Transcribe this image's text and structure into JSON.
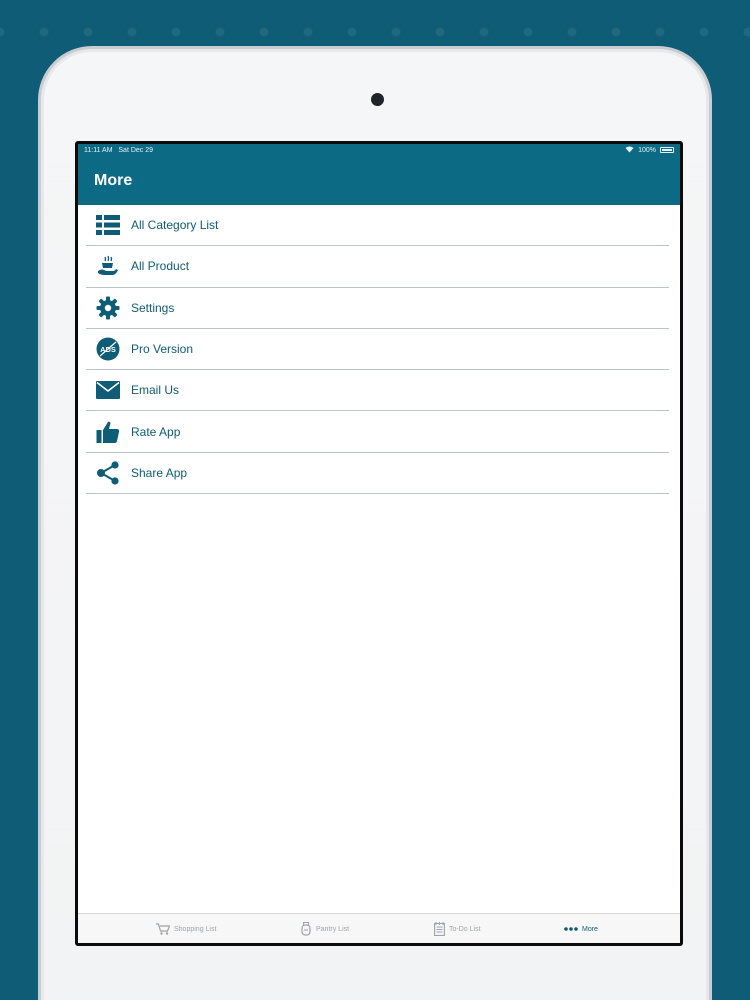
{
  "status_bar": {
    "time": "11:11 AM",
    "date": "Sat Dec 29",
    "battery": "100%"
  },
  "nav": {
    "title": "More"
  },
  "menu": [
    {
      "label": "All Category List",
      "icon": "list-icon"
    },
    {
      "label": "All Product",
      "icon": "product-hand-icon"
    },
    {
      "label": "Settings",
      "icon": "gear-icon"
    },
    {
      "label": "Pro Version",
      "icon": "no-ads-icon"
    },
    {
      "label": "Email Us",
      "icon": "envelope-icon"
    },
    {
      "label": "Rate App",
      "icon": "thumbs-up-icon"
    },
    {
      "label": "Share App",
      "icon": "share-icon"
    }
  ],
  "tabs": [
    {
      "label": "Shopping List",
      "icon": "cart-icon",
      "active": false
    },
    {
      "label": "Pantry List",
      "icon": "pantry-icon",
      "active": false
    },
    {
      "label": "To-Do List",
      "icon": "notepad-icon",
      "active": false
    },
    {
      "label": "More",
      "icon": "more-dots-icon",
      "active": true
    }
  ],
  "colors": {
    "brand": "#0d6a84",
    "text": "#0e5c75",
    "tab_inactive": "#9ea3a6",
    "background": "#0e5c75"
  },
  "ads_icon_text": "ADS"
}
